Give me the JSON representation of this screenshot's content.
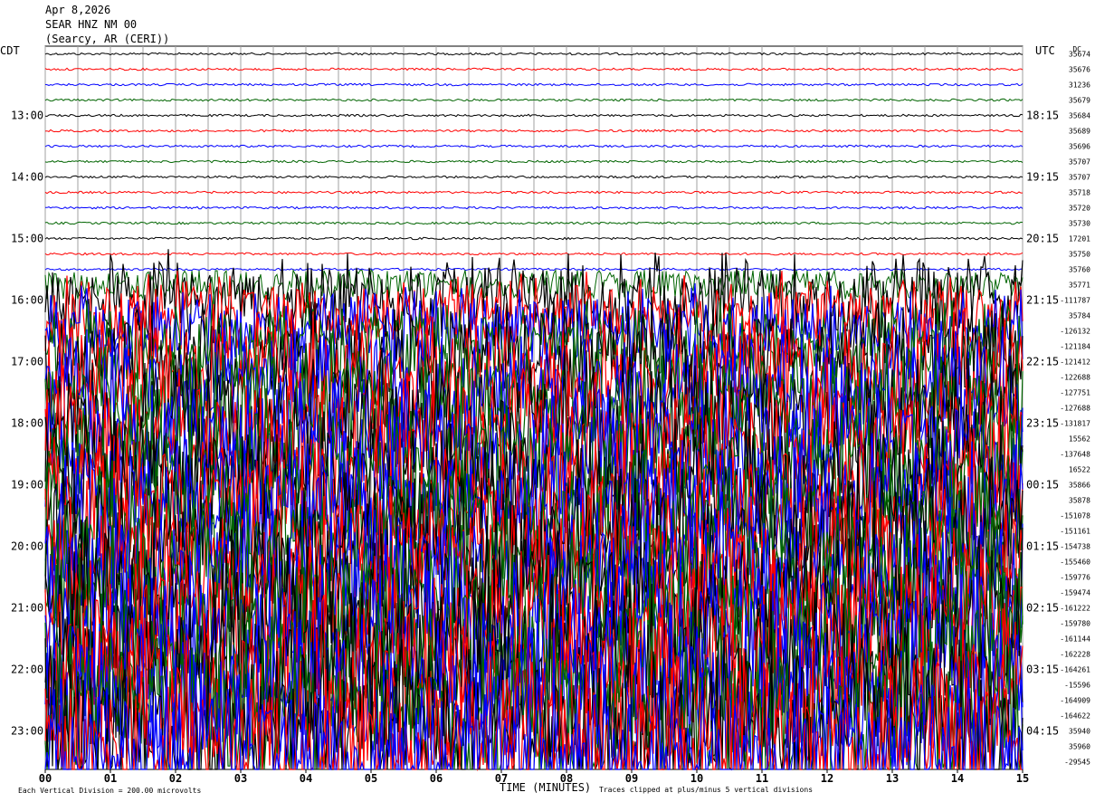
{
  "header": {
    "date": "Apr 8,2026",
    "station": "SEAR HNZ NM 00",
    "location": "(Searcy, AR (CERI))"
  },
  "left_axis_title": "CDT",
  "right_axis_title": "UTC",
  "dc_column_title": "DC",
  "footer": {
    "scale_note": "Each Vertical Division =  200.00 microvolts",
    "xlabel": "TIME (MINUTES)",
    "clip_note": "Traces clipped at plus/minus 5 vertical divisions"
  },
  "colors": {
    "black": "#000000",
    "red": "#ff0000",
    "blue": "#0000ff",
    "green": "#006400",
    "grid": "#a0a0a0"
  },
  "chart_data": {
    "type": "line",
    "title": "SEAR HNZ NM 00",
    "xlabel": "TIME (MINUTES)",
    "xlim": [
      0,
      15
    ],
    "x_ticks": [
      0,
      1,
      2,
      3,
      4,
      5,
      6,
      7,
      8,
      9,
      10,
      11,
      12,
      13,
      14,
      15
    ],
    "x_tick_labels": [
      "00",
      "01",
      "02",
      "03",
      "04",
      "05",
      "06",
      "07",
      "08",
      "09",
      "10",
      "11",
      "12",
      "13",
      "14",
      "15"
    ],
    "left_time_labels": [
      "13:00",
      "14:00",
      "15:00",
      "16:00",
      "17:00",
      "18:00",
      "19:00",
      "20:00",
      "21:00",
      "22:00",
      "23:00"
    ],
    "right_time_labels": [
      "18:15",
      "19:15",
      "20:15",
      "21:15",
      "22:15",
      "23:15",
      "00:15",
      "01:15",
      "02:15",
      "03:15",
      "04:15"
    ],
    "trace_colors_cycle": [
      "black",
      "red",
      "blue",
      "green"
    ],
    "trace_dc_offsets": [
      "35674",
      "35676",
      "31236",
      "35679",
      "35684",
      "35689",
      "35696",
      "35707",
      "35707",
      "35718",
      "35720",
      "35730",
      "17201",
      "35750",
      "35760",
      "35771",
      "-111787",
      "35784",
      "-126132",
      "-121184",
      "-121412",
      "-122688",
      "-127751",
      "-127688",
      "-131817",
      "15562",
      "-137648",
      "16522",
      "35866",
      "35878",
      "-151078",
      "-151161",
      "-154738",
      "-155460",
      "-159776",
      "-159474",
      "-161222",
      "-159780",
      "-161144",
      "-162228",
      "-164261",
      "-15596",
      "-164909",
      "-164622",
      "35940",
      "35960",
      "-29545"
    ],
    "trace_activity": [
      0.12,
      0.12,
      0.1,
      0.12,
      0.12,
      0.12,
      0.12,
      0.12,
      0.12,
      0.12,
      0.12,
      0.15,
      0.2,
      0.2,
      0.25,
      0.6,
      1.5,
      1.4,
      1.5,
      1.5,
      2.0,
      2.3,
      2.3,
      2.3,
      2.4,
      2.4,
      2.4,
      2.6,
      2.4,
      2.4,
      2.6,
      2.7,
      2.7,
      2.6,
      2.8,
      2.8,
      2.8,
      2.8,
      2.9,
      3.0,
      3.0,
      3.0,
      3.0,
      3.2,
      3.0,
      3.3,
      3.4
    ]
  }
}
